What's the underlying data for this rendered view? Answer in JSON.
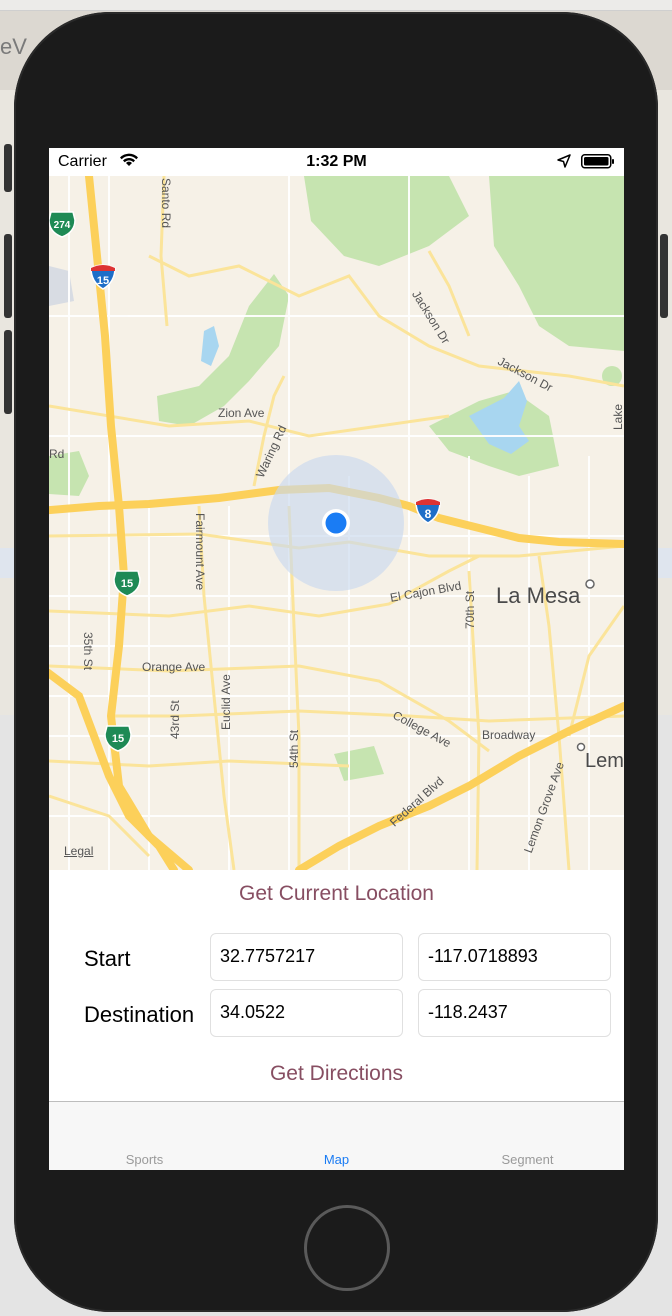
{
  "background": {
    "title_fragment": "eV"
  },
  "status_bar": {
    "carrier": "Carrier",
    "time": "1:32 PM"
  },
  "map": {
    "labels": {
      "santo_rd": "Santo Rd",
      "jackson_dr_1": "Jackson Dr",
      "jackson_dr_2": "Jackson Dr",
      "zion_ave": "Zion Ave",
      "waring_rd": "Waring Rd",
      "rd_left": "Rd",
      "fairmount_ave": "Fairmount Ave",
      "el_cajon_blvd": "El Cajon Blvd",
      "la_mesa": "La Mesa",
      "seventieth_st": "70th St",
      "thirty_fifth_st": "35th St",
      "orange_ave": "Orange Ave",
      "forty_third_st": "43rd St",
      "euclid_ave": "Euclid Ave",
      "fifty_fourth_st": "54th St",
      "college_ave": "College Ave",
      "broadway": "Broadway",
      "federal_blvd": "Federal Blvd",
      "lemon_grove_ave": "Lemon Grove Ave",
      "lem": "Lem",
      "lake": "Lake",
      "legal": "Legal"
    },
    "shields": {
      "i15": "15",
      "i8": "8",
      "sr274": "274",
      "sr15a": "15",
      "sr15b": "15"
    },
    "colors": {
      "highway": "#fcd05a",
      "park": "#c6e4b0",
      "water": "#a8d6f0",
      "land": "#f6f1e7",
      "user_dot": "#1a7cf4"
    }
  },
  "form": {
    "get_location": "Get Current Location",
    "start_label": "Start",
    "start_lat": "32.7757217",
    "start_lng": "-117.0718893",
    "dest_label": "Destination",
    "dest_lat": "34.0522",
    "dest_lng": "-118.2437",
    "get_directions": "Get Directions"
  },
  "tab_bar": {
    "tabs": [
      {
        "label": "Sports"
      },
      {
        "label": "Map"
      },
      {
        "label": "Segment"
      }
    ],
    "active_color": "#1a7cf4"
  }
}
